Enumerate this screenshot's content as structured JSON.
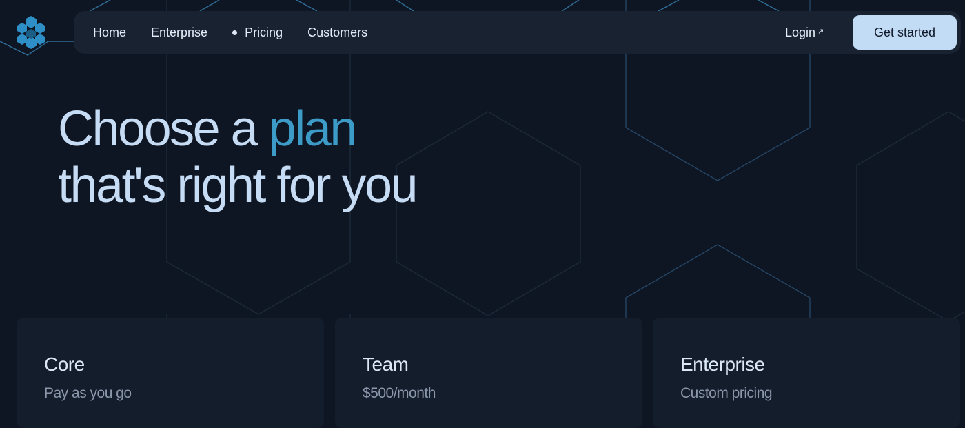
{
  "nav": {
    "logo_icon": "hexagon-cluster-icon",
    "links": [
      {
        "label": "Home"
      },
      {
        "label": "Enterprise"
      },
      {
        "label": "Pricing",
        "active": true
      },
      {
        "label": "Customers"
      }
    ],
    "login_label": "Login",
    "login_icon": "arrow-up-right-icon",
    "cta_label": "Get started"
  },
  "hero": {
    "line1_prefix": "Choose a",
    "line1_accent": "plan",
    "line2": "that's right for you"
  },
  "plans": [
    {
      "name": "Core",
      "price": "Pay as you go"
    },
    {
      "name": "Team",
      "price": "$500/month"
    },
    {
      "name": "Enterprise",
      "price": "Custom pricing"
    }
  ],
  "colors": {
    "background": "#0f1623",
    "accent": "#3d9bc8",
    "cta_background": "#c3dcf6",
    "heading": "#c6dcf4"
  }
}
